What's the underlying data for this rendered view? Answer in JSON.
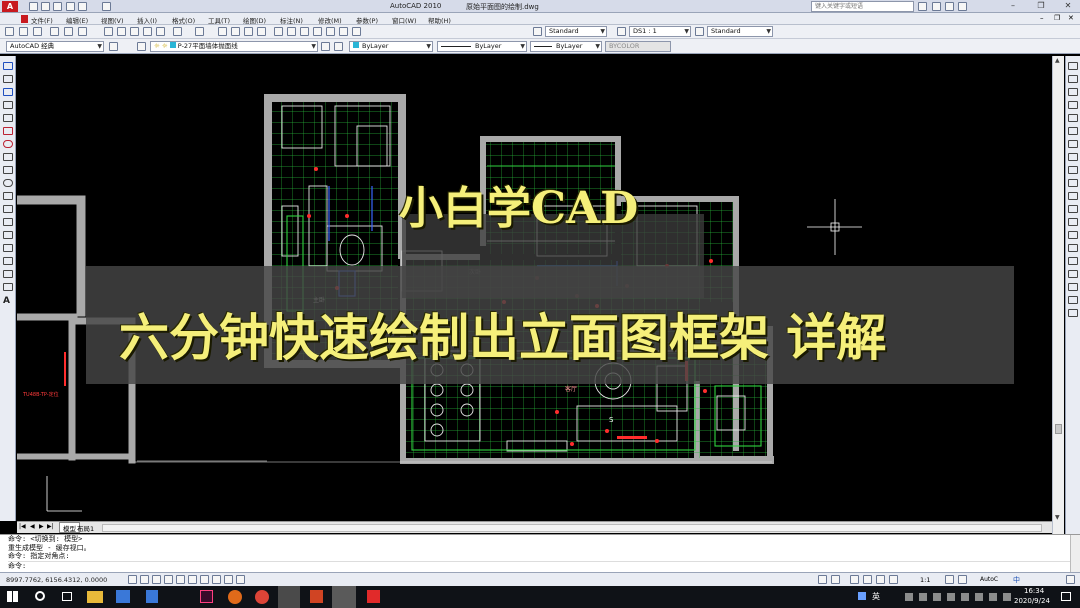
{
  "app": {
    "title": "AutoCAD 2010",
    "filename": "原始平面图的绘制.dwg",
    "search_placeholder": "键入关键字或短语"
  },
  "menu": [
    "文件(F)",
    "编辑(E)",
    "视图(V)",
    "插入(I)",
    "格式(O)",
    "工具(T)",
    "绘图(D)",
    "标注(N)",
    "修改(M)",
    "参数(P)",
    "窗口(W)",
    "帮助(H)"
  ],
  "toolbar": {
    "text_style": "Standard",
    "dim_style": "DS1 : 1",
    "table_style": "Standard",
    "workspace": "AutoCAD 经典",
    "layer": "P-27平面墙体抛面线",
    "color": "ByLayer",
    "linetype": "ByLayer",
    "lineweight": "ByLayer",
    "plotstyle": "BYCOLOR"
  },
  "drawing": {
    "room_labels": [
      "客厅",
      "次卧",
      "主卧"
    ],
    "left_label": "TU48B-TP-定位",
    "marker": "S"
  },
  "overlay": {
    "line1": "小白学CAD",
    "line2": "六分钟快速绘制出立面图框架 详解"
  },
  "tabs": {
    "model": "模型",
    "layout": "布局1"
  },
  "command_lines": [
    "命令:  <切换到: 模型>",
    "重生成模型 - 缓存视口。",
    "命令: 指定对角点:",
    "命令:"
  ],
  "status": {
    "coords": "8997.7762,  6156.4312,  0.0000",
    "scale": "1:1",
    "annotation": "AutoC",
    "lang": "中"
  },
  "taskbar": {
    "ime": "英",
    "time": "16:34",
    "date": "2020/9/24"
  },
  "colors": {
    "title_yellow": "#f5ef7a",
    "grid_green": "#2fd23f",
    "wall_gray": "#a9a9a9",
    "accent_red": "#ff2d2d"
  }
}
